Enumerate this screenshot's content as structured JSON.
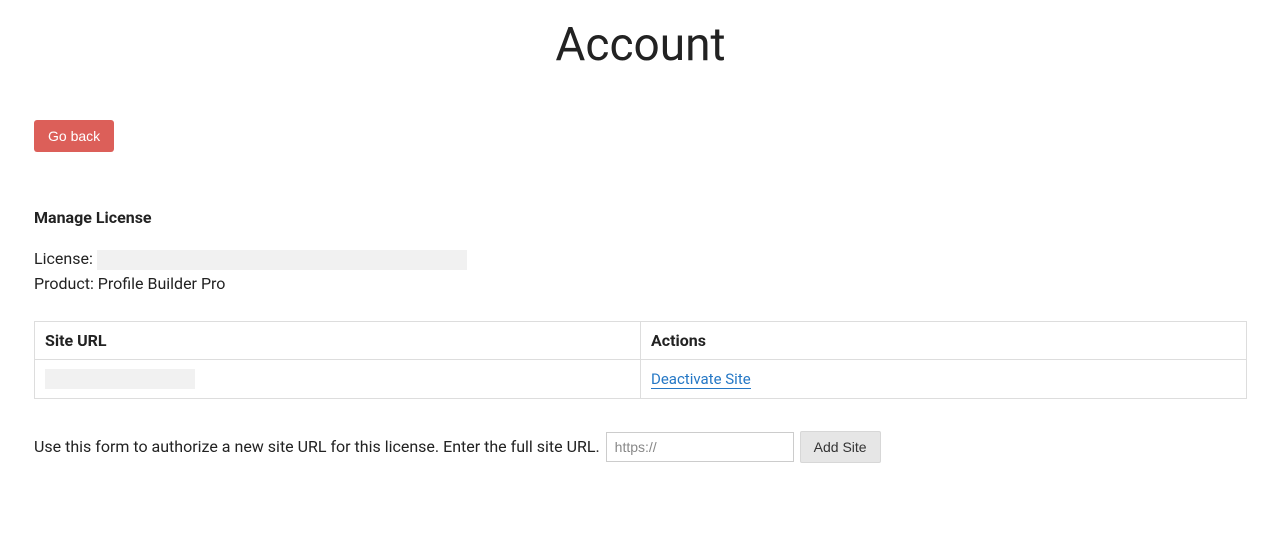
{
  "title": "Account",
  "go_back_label": "Go back",
  "manage_heading": "Manage License",
  "license_label": "License:",
  "product_label": "Product:",
  "product_value": "Profile Builder Pro",
  "table": {
    "col_url": "Site URL",
    "col_actions": "Actions",
    "deactivate_label": "Deactivate Site"
  },
  "form": {
    "prompt": "Use this form to authorize a new site URL for this license. Enter the full site URL.",
    "placeholder": "https://",
    "add_label": "Add Site"
  }
}
